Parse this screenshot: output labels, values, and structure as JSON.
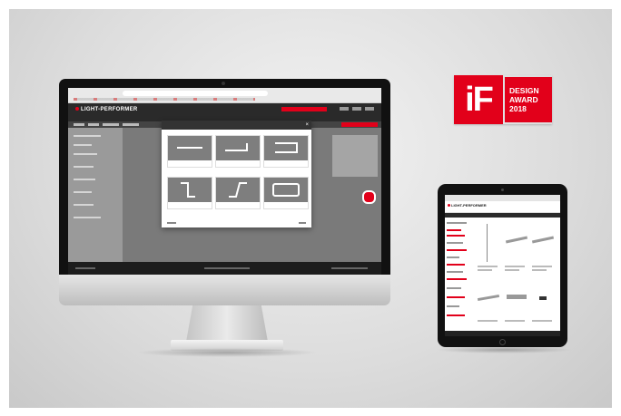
{
  "award": {
    "logo": "iF",
    "line1": "DESIGN",
    "line2": "AWARD",
    "line3": "2018",
    "color": "#e2001a"
  },
  "desktop": {
    "brand": "LIGHT-PERFORMER",
    "modal": {
      "tiles": [
        {
          "shape": "straight"
        },
        {
          "shape": "l-shape"
        },
        {
          "shape": "u-shape"
        },
        {
          "shape": "z-shape"
        },
        {
          "shape": "s-shape"
        },
        {
          "shape": "rectangle"
        }
      ]
    }
  },
  "tablet": {
    "brand": "LIGHT-PERFORMER"
  },
  "colors": {
    "accent": "#e2001a",
    "dark": "#2a2a2a"
  }
}
